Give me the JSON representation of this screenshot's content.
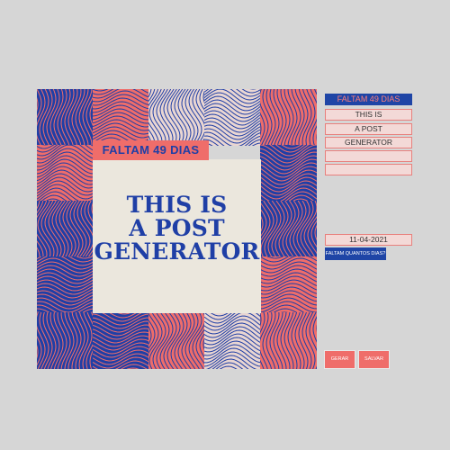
{
  "poster": {
    "countdown_tag": "FALTAM 49 DIAS",
    "headline": [
      "THIS IS",
      "A POST",
      "GENERATOR"
    ],
    "colors": {
      "blue": "#1f3fa6",
      "coral": "#ef6d6a",
      "cream": "#ebe7dd",
      "cream_accent": "#e9d6d2"
    },
    "tile_colors": [
      [
        "blue",
        "coral",
        "cream",
        "cream",
        "coral"
      ],
      [
        "coral",
        "coral",
        "",
        "",
        "blue"
      ],
      [
        "blue",
        "",
        "",
        "",
        "blue"
      ],
      [
        "blue",
        "",
        "",
        "",
        "coral"
      ],
      [
        "blue",
        "blue",
        "coral",
        "cream",
        "coral"
      ]
    ]
  },
  "controls": {
    "fields": [
      "FALTAM 49 DIAS",
      "THIS IS",
      "A POST",
      "GENERATOR",
      "",
      ""
    ],
    "date_value": "11-04-2021",
    "days_button": "FALTAM QUANTOS DIAS?",
    "generate_button": "GERAR",
    "save_button": "SALVAR"
  }
}
